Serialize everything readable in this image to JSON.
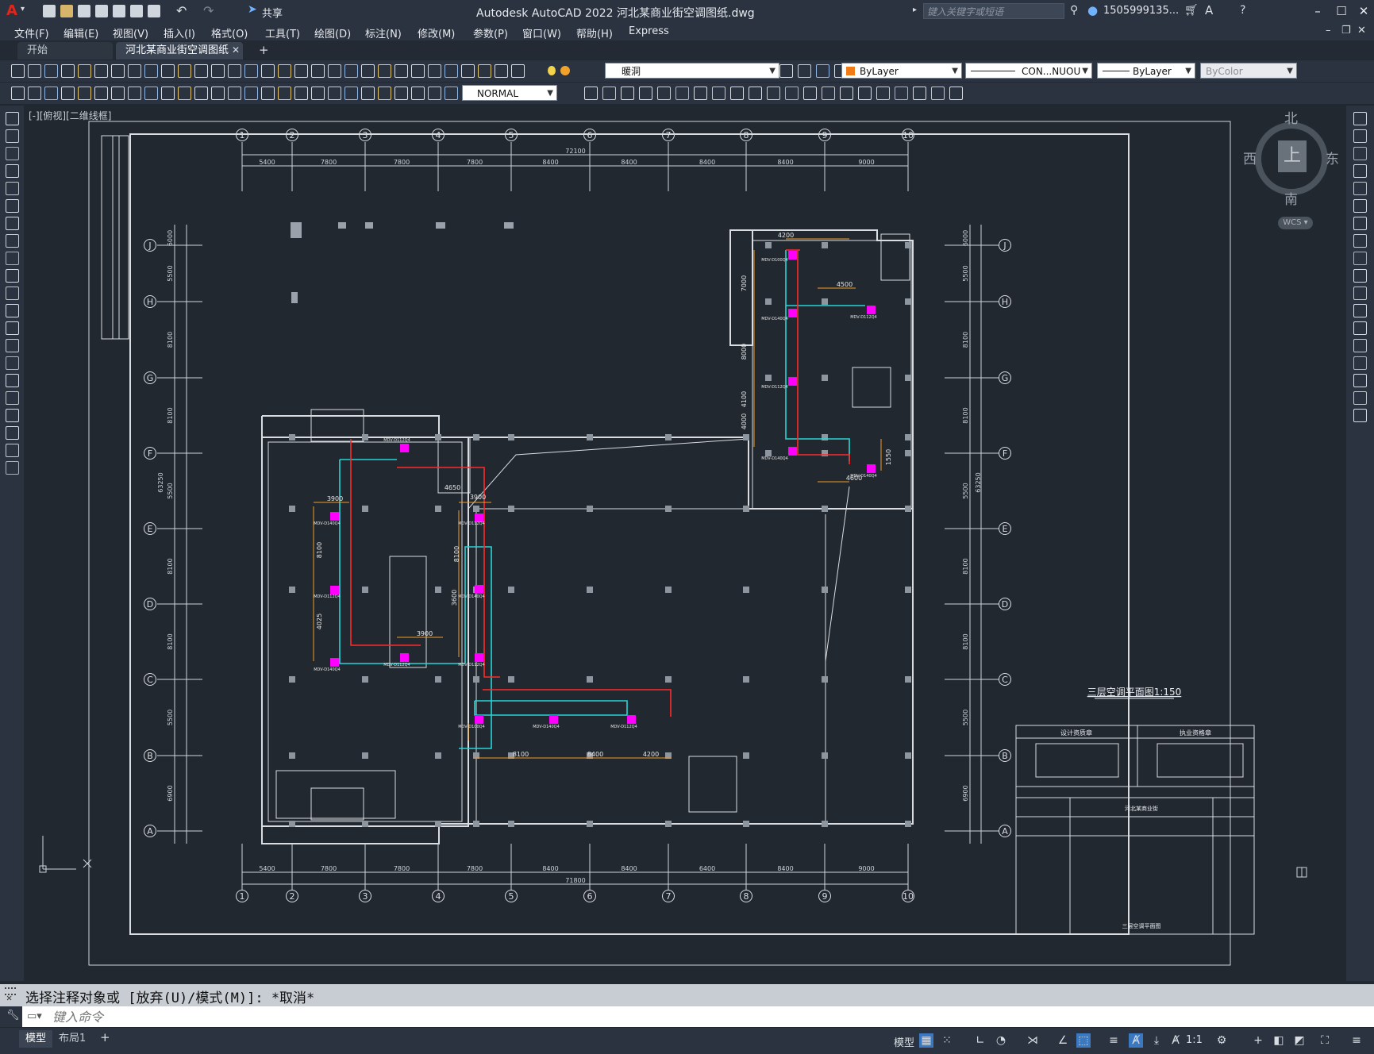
{
  "title_bar": {
    "title": "Autodesk AutoCAD 2022    河北某商业街空调图纸.dwg",
    "share_label": "共享",
    "search_placeholder": "键入关键字或短语",
    "user": "1505999135...",
    "logo_letter": "A"
  },
  "menu": [
    "文件(F)",
    "编辑(E)",
    "视图(V)",
    "插入(I)",
    "格式(O)",
    "工具(T)",
    "绘图(D)",
    "标注(N)",
    "修改(M)",
    "参数(P)",
    "窗口(W)",
    "帮助(H)",
    "Express"
  ],
  "tabs": [
    {
      "label": "开始",
      "active": false
    },
    {
      "label": "河北某商业街空调图纸*",
      "active": true
    }
  ],
  "properties": {
    "layer": "暖洞",
    "color": "ByLayer",
    "linetype": "CON...NUOU",
    "lineweight": "ByLayer",
    "plotstyle": "ByColor",
    "dimstyle": "NORMAL"
  },
  "viewport_label": "[-][俯视][二维线框]",
  "viewcube": {
    "north": "北",
    "south": "南",
    "east": "东",
    "west": "西",
    "top": "上",
    "wcs": "WCS"
  },
  "drawing": {
    "grid_cols": [
      "1",
      "2",
      "3",
      "4",
      "5",
      "6",
      "7",
      "8",
      "9",
      "10"
    ],
    "grid_rows": [
      "J",
      "H",
      "G",
      "F",
      "E",
      "D",
      "C",
      "B",
      "A"
    ],
    "top_dims": [
      "5400",
      "7800",
      "7800",
      "7800",
      "8400",
      "8400",
      "8400",
      "8400",
      "9000"
    ],
    "top_total": "72100",
    "bottom_dims": [
      "5400",
      "7800",
      "7800",
      "7800",
      "8400",
      "8400",
      "6400",
      "8400",
      "9000"
    ],
    "bottom_total": "71800",
    "side_dims": [
      "6000",
      "5500",
      "8100",
      "8100",
      "5500",
      "8100",
      "8100",
      "5500",
      "6900"
    ],
    "side_total": "63250",
    "plan_title": "三层空调平面图1:150",
    "stamp_left": "设计资质章",
    "stamp_right": "执业资格章",
    "project_name": "河北某商业街",
    "drawing_name": "三层空调平面图",
    "units": [
      "MDV-D112Q4",
      "MDV-D140Q4",
      "MDV-D112Q4",
      "MDV-D140Q4",
      "MDV-D112Q4",
      "MDV-D112Q4",
      "MDV-D140Q4",
      "MDV-D112Q4",
      "MDV-D100Q4",
      "MDV-D140Q4",
      "MDV-D112Q4",
      "MDV-D100Q4",
      "MDV-D140Q4",
      "MDV-D112Q4",
      "MDV-D140Q4"
    ],
    "dim_labels": [
      "3900",
      "3900",
      "3900",
      "4200",
      "4500",
      "4600",
      "8100",
      "8400",
      "4200",
      "7000",
      "8000",
      "4100",
      "4000",
      "4650",
      "8100",
      "8100",
      "4025",
      "3600",
      "1550"
    ]
  },
  "command": {
    "history": "选择注释对象或 [放弃(U)/模式(M)]: *取消*",
    "placeholder": "键入命令"
  },
  "status": {
    "model_tab": "模型",
    "layout_tab": "布局1",
    "model_btn": "模型",
    "scale": "1:1"
  }
}
